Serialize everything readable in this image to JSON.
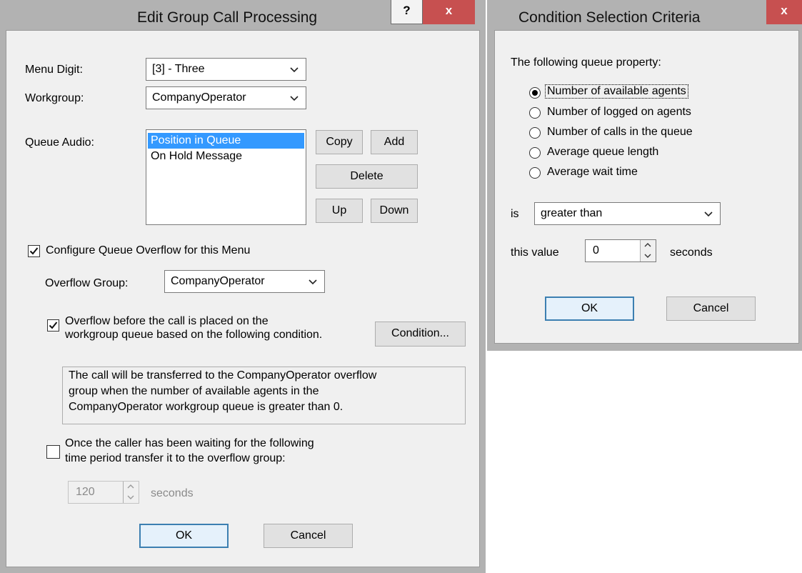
{
  "edit_dialog": {
    "title": "Edit Group Call Processing",
    "help_label": "?",
    "close_label": "x",
    "menu_digit_label": "Menu Digit:",
    "menu_digit_value": "[3] - Three",
    "workgroup_label": "Workgroup:",
    "workgroup_value": "CompanyOperator",
    "queue_audio_label": "Queue Audio:",
    "queue_audio_items": [
      "Position in Queue",
      "On Hold Message"
    ],
    "buttons": {
      "copy": "Copy",
      "add": "Add",
      "delete": "Delete",
      "up": "Up",
      "down": "Down"
    },
    "configure_overflow_label": "Configure Queue Overflow for this Menu",
    "configure_overflow_checked": true,
    "overflow_group_label": "Overflow Group:",
    "overflow_group_value": "CompanyOperator",
    "overflow_before_line1": "Overflow before the call is placed on the",
    "overflow_before_line2": "workgroup queue based on the following condition.",
    "overflow_before_checked": true,
    "condition_button": "Condition...",
    "info_line1": "The call will be transferred to the CompanyOperator overflow",
    "info_line2": "group when the number of available agents in the",
    "info_line3": "CompanyOperator workgroup queue is greater than 0.",
    "waiting_line1": "Once the caller has been waiting for the following",
    "waiting_line2": "time period transfer it to the overflow group:",
    "waiting_checked": false,
    "waiting_value": "120",
    "waiting_unit": "seconds",
    "ok": "OK",
    "cancel": "Cancel"
  },
  "condition_dialog": {
    "title": "Condition Selection Criteria",
    "close_label": "x",
    "property_label": "The following queue property:",
    "options": [
      "Number of available agents",
      "Number of logged on agents",
      "Number of calls in the queue",
      "Average queue length",
      "Average wait time"
    ],
    "selected_index": 0,
    "is_label": "is",
    "comparison_value": "greater than",
    "this_value_label": "this value",
    "value": "0",
    "unit": "seconds",
    "ok": "OK",
    "cancel": "Cancel"
  },
  "icons": {
    "dropdown": "chevron-down-icon",
    "check": "checkmark-icon",
    "spin_up": "spin-up-icon",
    "spin_down": "spin-down-icon"
  },
  "colors": {
    "frame": "#b2b2b2",
    "client_bg": "#f0f0f0",
    "selection": "#3399ff",
    "close_red": "#c75050",
    "default_button_border": "#3c7fb1"
  }
}
